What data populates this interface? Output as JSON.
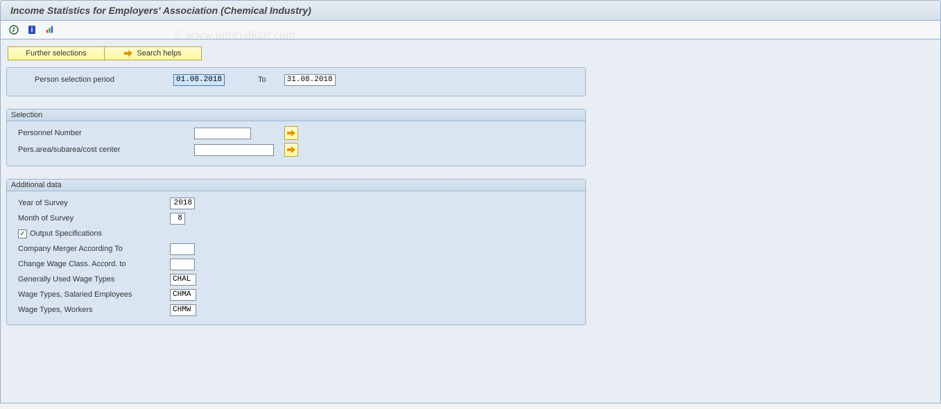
{
  "title": "Income Statistics for Employers' Association (Chemical Industry)",
  "watermark": "© www.tutorialkart.com",
  "buttons": {
    "further_selections": "Further selections",
    "search_helps": "Search helps"
  },
  "period": {
    "label": "Person selection period",
    "from": "01.08.2018",
    "to_label": "To",
    "to": "31.08.2018"
  },
  "selection": {
    "header": "Selection",
    "personnel_number_label": "Personnel Number",
    "personnel_number_value": "",
    "pers_area_label": "Pers.area/subarea/cost center",
    "pers_area_value": ""
  },
  "additional": {
    "header": "Additional data",
    "year_label": "Year of Survey",
    "year_value": "2018",
    "month_label": "Month of Survey",
    "month_value": "8",
    "output_spec_label": "Output Specifications",
    "output_spec_checked": "✓",
    "company_merger_label": "Company Merger According To",
    "company_merger_value": "",
    "change_wage_label": "Change Wage Class. Accord. to",
    "change_wage_value": "",
    "gen_wage_label": "Generally Used Wage Types",
    "gen_wage_value": "CHAL",
    "sal_wage_label": "Wage Types, Salaried Employees",
    "sal_wage_value": "CHMA",
    "worker_wage_label": "Wage Types, Workers",
    "worker_wage_value": "CHMW"
  }
}
